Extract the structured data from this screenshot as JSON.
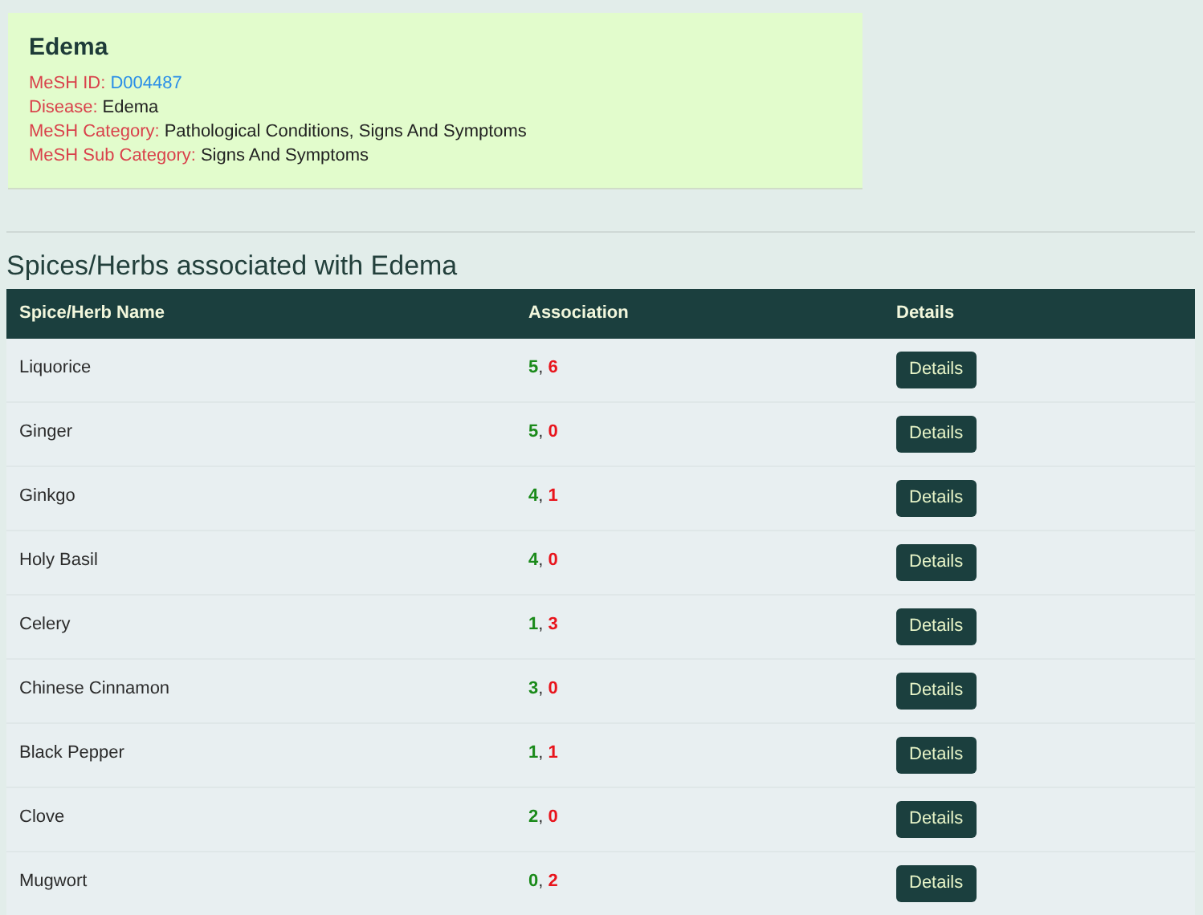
{
  "disease_card": {
    "title": "Edema",
    "fields": [
      {
        "label": "MeSH ID:",
        "value": "D004487",
        "kind": "link"
      },
      {
        "label": "Disease:",
        "value": "Edema",
        "kind": "text"
      },
      {
        "label": "MeSH Category:",
        "value": "Pathological Conditions, Signs And Symptoms",
        "kind": "text"
      },
      {
        "label": "MeSH Sub Category:",
        "value": "Signs And Symptoms",
        "kind": "text"
      }
    ]
  },
  "section_title": "Spices/Herbs associated with Edema",
  "table": {
    "columns": [
      "Spice/Herb Name",
      "Association",
      "Details"
    ],
    "rows": [
      {
        "name": "Liquorice",
        "positive": "5",
        "separator": ",",
        "negative": "6",
        "button": "Details"
      },
      {
        "name": "Ginger",
        "positive": "5",
        "separator": ",",
        "negative": "0",
        "button": "Details"
      },
      {
        "name": "Ginkgo",
        "positive": "4",
        "separator": ",",
        "negative": "1",
        "button": "Details"
      },
      {
        "name": "Holy Basil",
        "positive": "4",
        "separator": ",",
        "negative": "0",
        "button": "Details"
      },
      {
        "name": "Celery",
        "positive": "1",
        "separator": ",",
        "negative": "3",
        "button": "Details"
      },
      {
        "name": "Chinese Cinnamon",
        "positive": "3",
        "separator": ",",
        "negative": "0",
        "button": "Details"
      },
      {
        "name": "Black Pepper",
        "positive": "1",
        "separator": ",",
        "negative": "1",
        "button": "Details"
      },
      {
        "name": "Clove",
        "positive": "2",
        "separator": ",",
        "negative": "0",
        "button": "Details"
      },
      {
        "name": "Mugwort",
        "positive": "0",
        "separator": ",",
        "negative": "2",
        "button": "Details"
      }
    ]
  }
}
